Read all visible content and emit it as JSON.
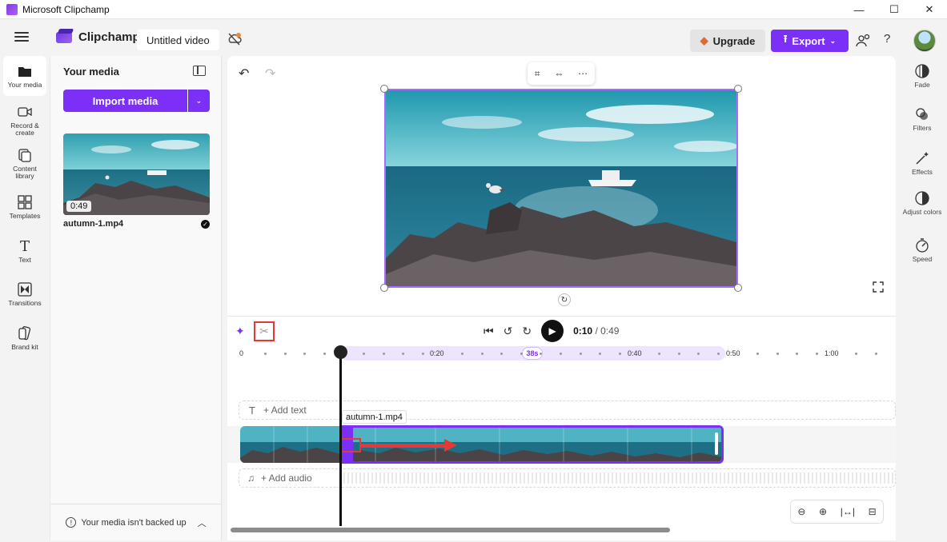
{
  "window": {
    "title": "Microsoft Clipchamp",
    "minimize": "—",
    "maximize": "☐",
    "close": "✕"
  },
  "topbar": {
    "brand": "Clipchamp",
    "project_name": "Untitled video",
    "upgrade_label": "Upgrade",
    "export_label": "Export",
    "help": "?"
  },
  "left_rail": [
    {
      "label": "Your media",
      "icon": "folder-icon"
    },
    {
      "label": "Record & create",
      "icon": "camera-icon"
    },
    {
      "label": "Content library",
      "icon": "library-icon"
    },
    {
      "label": "Templates",
      "icon": "templates-icon"
    },
    {
      "label": "Text",
      "icon": "text-icon"
    },
    {
      "label": "Transitions",
      "icon": "transitions-icon"
    },
    {
      "label": "Brand kit",
      "icon": "brand-kit-icon"
    }
  ],
  "media_panel": {
    "title": "Your media",
    "import_label": "Import media",
    "thumb_duration": "0:49",
    "filename": "autumn-1.mp4",
    "backup_text": "Your media isn't backed up"
  },
  "playback": {
    "current": "0:10",
    "total": "/ 0:49"
  },
  "ruler": {
    "labels": [
      "0",
      "0:20",
      "0:40",
      "0:50",
      "1:00"
    ],
    "range_label": "38s"
  },
  "tracks": {
    "add_text": "+ Add text",
    "add_audio": "+ Add audio",
    "clip_name": "autumn-1.mp4"
  },
  "right_rail": [
    {
      "label": "Fade",
      "icon": "fade-icon"
    },
    {
      "label": "Filters",
      "icon": "filters-icon"
    },
    {
      "label": "Effects",
      "icon": "effects-icon"
    },
    {
      "label": "Adjust colors",
      "icon": "adjust-colors-icon"
    },
    {
      "label": "Speed",
      "icon": "speed-icon"
    }
  ],
  "colors": {
    "accent": "#7b2ff7",
    "highlight_red": "#e53935"
  }
}
